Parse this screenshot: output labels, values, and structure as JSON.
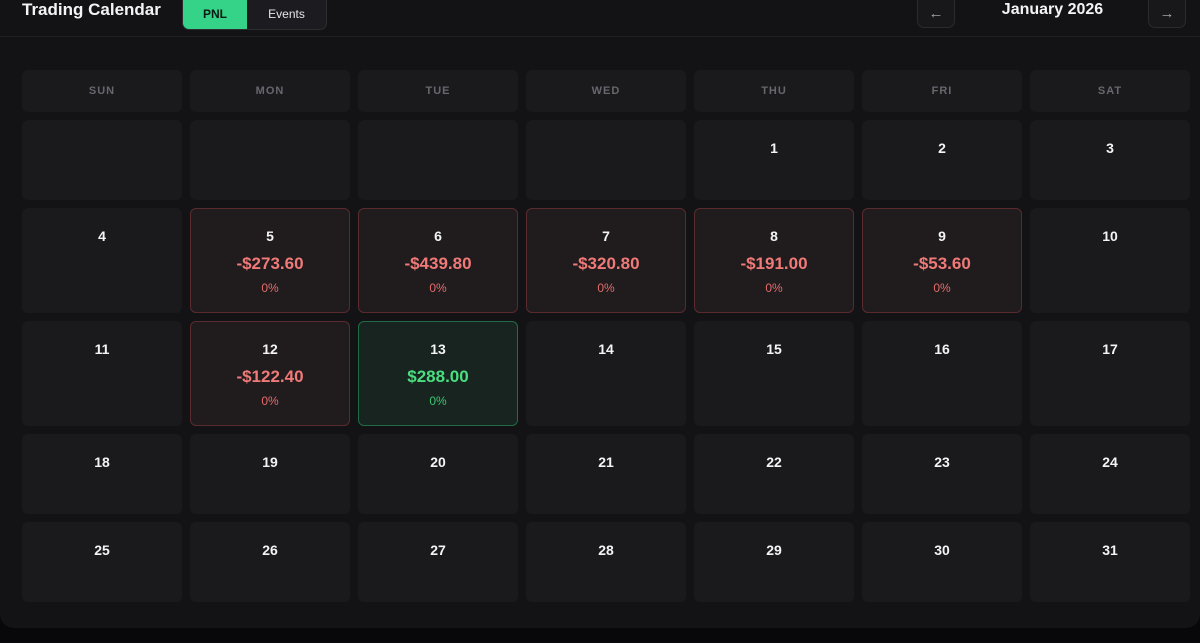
{
  "header": {
    "title": "Trading Calendar",
    "toggle": {
      "pnl_label": "PNL",
      "events_label": "Events",
      "selected": "PNL"
    },
    "prev_label": "←",
    "next_label": "→",
    "month_label": "January 2026"
  },
  "weekdays": [
    "SUN",
    "MON",
    "TUE",
    "WED",
    "THU",
    "FRI",
    "SAT"
  ],
  "colors": {
    "accent": "#34d388",
    "loss": "#f07a78",
    "gain": "#4ade80",
    "background": "#131316"
  },
  "days": [
    {
      "day": ""
    },
    {
      "day": ""
    },
    {
      "day": ""
    },
    {
      "day": ""
    },
    {
      "day": "1"
    },
    {
      "day": "2"
    },
    {
      "day": "3"
    },
    {
      "day": "4"
    },
    {
      "day": "5",
      "pnl": "-$273.60",
      "pct": "0%",
      "status": "loss"
    },
    {
      "day": "6",
      "pnl": "-$439.80",
      "pct": "0%",
      "status": "loss"
    },
    {
      "day": "7",
      "pnl": "-$320.80",
      "pct": "0%",
      "status": "loss"
    },
    {
      "day": "8",
      "pnl": "-$191.00",
      "pct": "0%",
      "status": "loss"
    },
    {
      "day": "9",
      "pnl": "-$53.60",
      "pct": "0%",
      "status": "loss"
    },
    {
      "day": "10"
    },
    {
      "day": "11"
    },
    {
      "day": "12",
      "pnl": "-$122.40",
      "pct": "0%",
      "status": "loss"
    },
    {
      "day": "13",
      "pnl": "$288.00",
      "pct": "0%",
      "status": "gain"
    },
    {
      "day": "14"
    },
    {
      "day": "15"
    },
    {
      "day": "16"
    },
    {
      "day": "17"
    },
    {
      "day": "18"
    },
    {
      "day": "19"
    },
    {
      "day": "20"
    },
    {
      "day": "21"
    },
    {
      "day": "22"
    },
    {
      "day": "23"
    },
    {
      "day": "24"
    },
    {
      "day": "25"
    },
    {
      "day": "26"
    },
    {
      "day": "27"
    },
    {
      "day": "28"
    },
    {
      "day": "29"
    },
    {
      "day": "30"
    },
    {
      "day": "31"
    }
  ]
}
